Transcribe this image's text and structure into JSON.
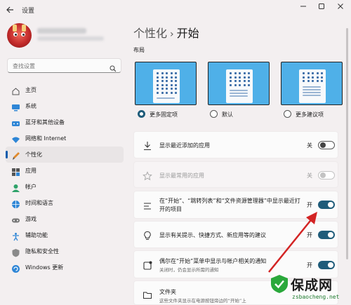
{
  "window": {
    "title": "设置",
    "back_icon": "arrow-left-icon",
    "controls": [
      "minimize-icon",
      "maximize-icon",
      "close-icon"
    ]
  },
  "search": {
    "placeholder": "查找设置"
  },
  "nav": {
    "items": [
      {
        "label": "主页",
        "icon": "home-icon",
        "active": false
      },
      {
        "label": "系统",
        "icon": "monitor-icon",
        "active": false
      },
      {
        "label": "蓝牙和其他设备",
        "icon": "bluetooth-icon",
        "active": false
      },
      {
        "label": "网络和 Internet",
        "icon": "wifi-icon",
        "active": false
      },
      {
        "label": "个性化",
        "icon": "brush-icon",
        "active": true
      },
      {
        "label": "应用",
        "icon": "apps-icon",
        "active": false
      },
      {
        "label": "帐户",
        "icon": "person-icon",
        "active": false
      },
      {
        "label": "时间和语言",
        "icon": "globe-icon",
        "active": false
      },
      {
        "label": "游戏",
        "icon": "gamepad-icon",
        "active": false
      },
      {
        "label": "辅助功能",
        "icon": "accessibility-icon",
        "active": false
      },
      {
        "label": "隐私和安全性",
        "icon": "shield-icon",
        "active": false
      },
      {
        "label": "Windows 更新",
        "icon": "update-icon",
        "active": false
      }
    ]
  },
  "header": {
    "parent": "个性化",
    "separator": "›",
    "current": "开始"
  },
  "layout": {
    "label": "布局",
    "options": [
      {
        "label": "更多固定项",
        "selected": true
      },
      {
        "label": "默认",
        "selected": false
      },
      {
        "label": "更多建议项",
        "selected": false
      }
    ]
  },
  "settings": [
    {
      "text": "显示最近添加的应用",
      "sub": "",
      "state": "关",
      "on": false,
      "disabled": false,
      "icon": "download-icon"
    },
    {
      "text": "显示最常用的应用",
      "sub": "",
      "state": "关",
      "on": false,
      "disabled": true,
      "icon": "star-icon"
    },
    {
      "text": "在“开始”、“跳转列表”和“文件资源管理器”中显示最近打",
      "text2": "开的项目",
      "sub": "",
      "state": "开",
      "on": true,
      "disabled": false,
      "icon": "list-icon"
    },
    {
      "text": "显示有关提示、快捷方式、新应用等的建议",
      "sub": "",
      "state": "开",
      "on": true,
      "disabled": false,
      "icon": "lightbulb-icon"
    },
    {
      "text": "偶尔在“开始”菜单中显示与帐户相关的通知",
      "sub": "关闭时，仍会显示所需的通知",
      "state": "开",
      "on": true,
      "disabled": false,
      "icon": "notification-icon"
    },
    {
      "text": "文件夹",
      "sub": "这些文件夹显示在电源按钮旁边的“开始”上",
      "state": "",
      "on": false,
      "disabled": false,
      "icon": "folder-icon"
    }
  ],
  "watermark": {
    "text": "保成网",
    "url": "zsbaocheng.net"
  },
  "colors": {
    "accent": "#1f5c7a",
    "nav_indicator": "#0b5cad",
    "background": "#f3eff0",
    "annotation_arrow": "#d32424"
  }
}
